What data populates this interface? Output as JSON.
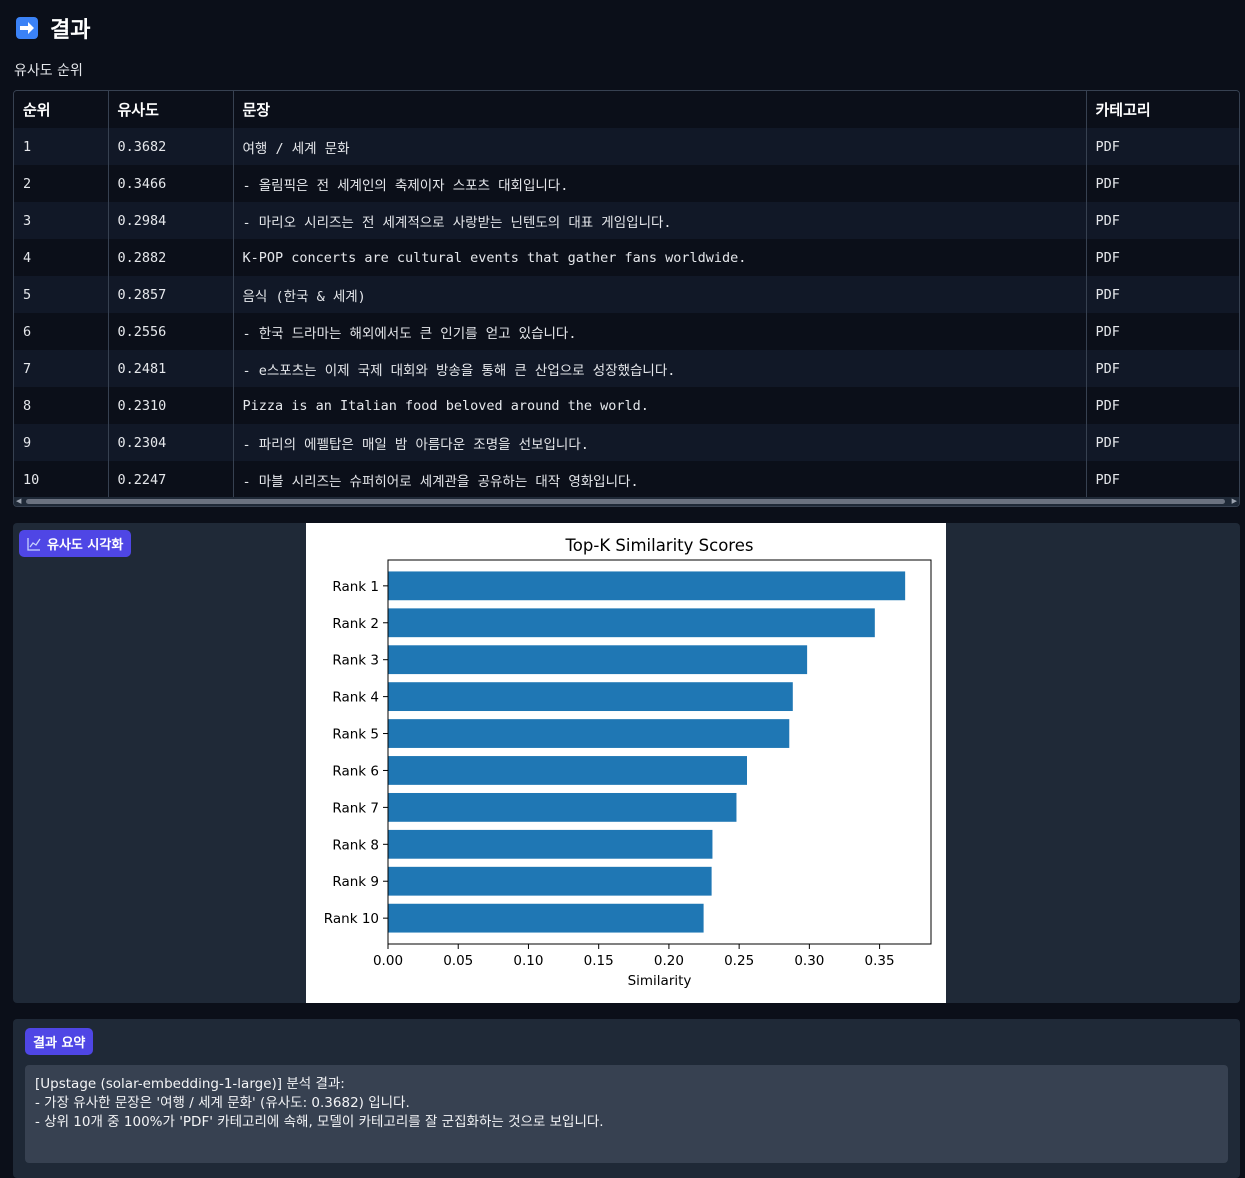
{
  "header": {
    "icon": "right-arrow-icon",
    "title": "결과"
  },
  "table": {
    "label": "유사도 순위",
    "columns": [
      "순위",
      "유사도",
      "문장",
      "카테고리"
    ],
    "rows": [
      [
        "1",
        "0.3682",
        "여행 / 세계 문화",
        "PDF"
      ],
      [
        "2",
        "0.3466",
        "- 올림픽은 전 세계인의 축제이자 스포츠 대회입니다.",
        "PDF"
      ],
      [
        "3",
        "0.2984",
        "- 마리오 시리즈는 전 세계적으로 사랑받는 닌텐도의 대표 게임입니다.",
        "PDF"
      ],
      [
        "4",
        "0.2882",
        "K-POP concerts are cultural events that gather fans worldwide.",
        "PDF"
      ],
      [
        "5",
        "0.2857",
        "음식 (한국 & 세계)",
        "PDF"
      ],
      [
        "6",
        "0.2556",
        "- 한국 드라마는 해외에서도 큰 인기를 얻고 있습니다.",
        "PDF"
      ],
      [
        "7",
        "0.2481",
        "- e스포츠는 이제 국제 대회와 방송을 통해 큰 산업으로 성장했습니다.",
        "PDF"
      ],
      [
        "8",
        "0.2310",
        "Pizza is an Italian food beloved around the world.",
        "PDF"
      ],
      [
        "9",
        "0.2304",
        "- 파리의 에펠탑은 매일 밤 아름다운 조명을 선보입니다.",
        "PDF"
      ],
      [
        "10",
        "0.2247",
        "- 마블 시리즈는 슈퍼히어로 세계관을 공유하는 대작 영화입니다.",
        "PDF"
      ]
    ]
  },
  "viz": {
    "badge": "유사도 시각화",
    "badge_icon": "chart-icon"
  },
  "chart_data": {
    "type": "bar",
    "orientation": "horizontal",
    "title": "Top-K Similarity Scores",
    "xlabel": "Similarity",
    "ylabel": "",
    "categories": [
      "Rank 1",
      "Rank 2",
      "Rank 3",
      "Rank 4",
      "Rank 5",
      "Rank 6",
      "Rank 7",
      "Rank 8",
      "Rank 9",
      "Rank 10"
    ],
    "values": [
      0.3682,
      0.3466,
      0.2984,
      0.2882,
      0.2857,
      0.2556,
      0.2481,
      0.231,
      0.2304,
      0.2247
    ],
    "xlim": [
      0,
      0.3866
    ],
    "xticks": [
      "0.00",
      "0.05",
      "0.10",
      "0.15",
      "0.20",
      "0.25",
      "0.30",
      "0.35"
    ],
    "bar_color": "#1f77b4",
    "grid": false
  },
  "summary": {
    "badge": "결과 요약",
    "lines": [
      "[Upstage (solar-embedding-1-large)] 분석 결과:",
      "- 가장 유사한 문장은 '여행 / 세계 문화' (유사도: 0.3682) 입니다.",
      "- 상위 10개 중 100%가 'PDF' 카테고리에 속해, 모델이 카테고리를 잘 군집화하는 것으로 보입니다."
    ]
  },
  "colors": {
    "accent": "#4f46e5",
    "background": "#0b0f19",
    "panel": "#1f2937",
    "bar": "#1f77b4"
  }
}
